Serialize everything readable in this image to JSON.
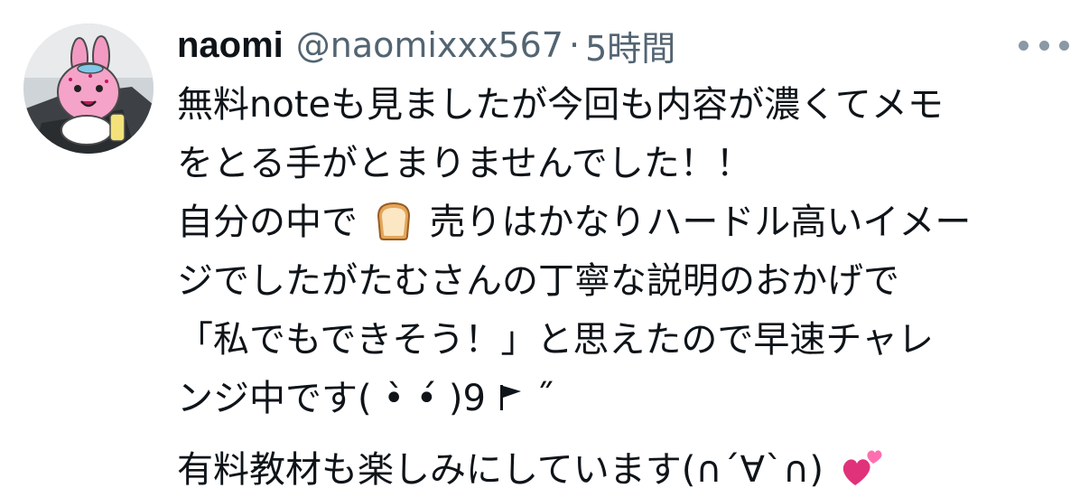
{
  "user": {
    "display_name": "naomi",
    "handle": "@naomixxx567",
    "separator": "·",
    "timestamp": "5時間"
  },
  "tweet": {
    "lines": [
      "無料noteも見ましたが今回も内容が濃くてメモ",
      "をとる手がとまりませんでした！！",
      "自分の中で",
      "売りはかなりハードル高いイメー",
      "ジでしたがたむさんの丁寧な説明のおかげで",
      "「私でもできそう！」と思えたので早速チャレ",
      "ンジ中です( ‌•̀ •́ )9",
      "有料教材も楽しみにしています(∩´∀`∩)"
    ],
    "kaomoji_end": "˝"
  },
  "icons": {
    "avatar": "avatar-pink-rabbit-icon",
    "more": "more-options-icon",
    "bread": "bread-emoji-icon",
    "hearts": "two-hearts-emoji-icon",
    "flag": "flag-icon"
  },
  "colors": {
    "text": "#0f1419",
    "secondary": "#536471",
    "more_dots": "#8b98a5",
    "heart": "#e0327a"
  }
}
